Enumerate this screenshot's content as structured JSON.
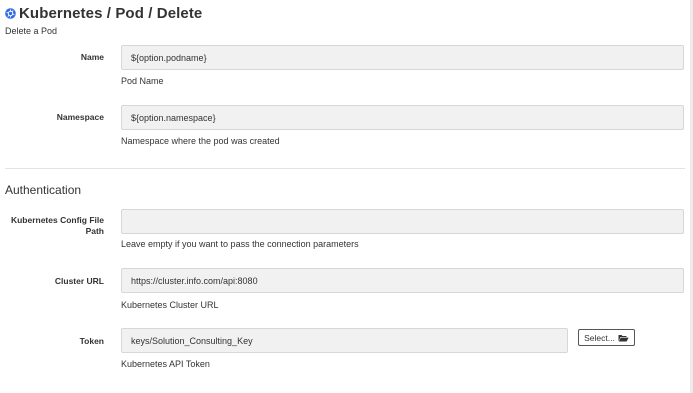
{
  "header": {
    "title": "Kubernetes / Pod / Delete",
    "subtitle": "Delete a Pod"
  },
  "fields": {
    "name": {
      "label": "Name",
      "value": "${option.podname}",
      "help": "Pod Name"
    },
    "namespace": {
      "label": "Namespace",
      "value": "${option.namespace}",
      "help": "Namespace where the pod was created"
    }
  },
  "auth": {
    "heading": "Authentication",
    "config_path": {
      "label": "Kubernetes Config File Path",
      "value": "",
      "help": "Leave empty if you want to pass the connection parameters"
    },
    "cluster_url": {
      "label": "Cluster URL",
      "value": "https://cluster.info.com/api:8080",
      "help": "Kubernetes Cluster URL"
    },
    "token": {
      "label": "Token",
      "value": "keys/Solution_Consulting_Key",
      "help": "Kubernetes API Token",
      "select_label": "Select..."
    }
  },
  "icons": {
    "title_icon": "kubernetes-icon",
    "select_icon": "folder-open-icon"
  },
  "colors": {
    "icon_blue": "#326ce5",
    "field_bg": "#f1f1f1"
  }
}
